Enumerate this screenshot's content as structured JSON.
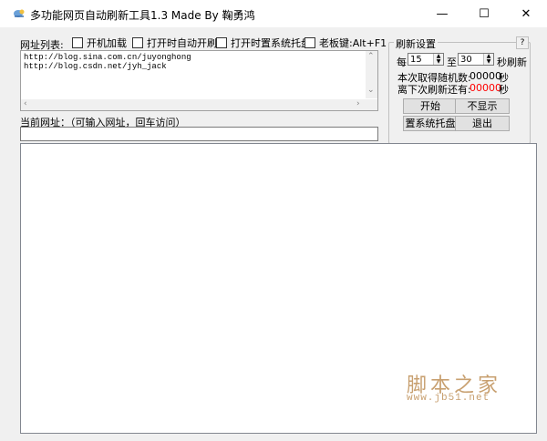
{
  "window": {
    "title": "多功能网页自动刷新工具1.3 Made By 鞠勇鸿",
    "minimize_glyph": "—",
    "maximize_glyph": "☐",
    "close_glyph": "✕"
  },
  "options": {
    "url_list_label": "网址列表:",
    "autostart_label": "开机加载",
    "auto_refresh_label": "打开时自动开刷",
    "tray_label": "打开时置系统托盘",
    "boss_key_label": "老板键:Alt+F1"
  },
  "url_list": {
    "lines": [
      "http://blog.sina.com.cn/juyonghong",
      "http://blog.csdn.net/jyh_jack"
    ]
  },
  "current_url": {
    "label": "当前网址：（可输入网址，回车访问）",
    "value": ""
  },
  "refresh_settings": {
    "title": "刷新设置",
    "help": "?",
    "every_label": "每",
    "min_seconds": "15",
    "to_label": "至",
    "max_seconds": "30",
    "seconds_refresh_label": "秒刷新",
    "random_label": "本次取得随机数:",
    "random_value": "00000",
    "random_unit": "秒",
    "next_label": "离下次刷新还有:",
    "next_value": "00000",
    "next_unit": "秒",
    "next_value_color": "#ff0000"
  },
  "buttons": {
    "start": "开始",
    "hide": "不显示",
    "tray": "置系统托盘",
    "exit": "退出"
  },
  "watermark": {
    "text": "脚本之家",
    "url": "www.jb51.net"
  }
}
